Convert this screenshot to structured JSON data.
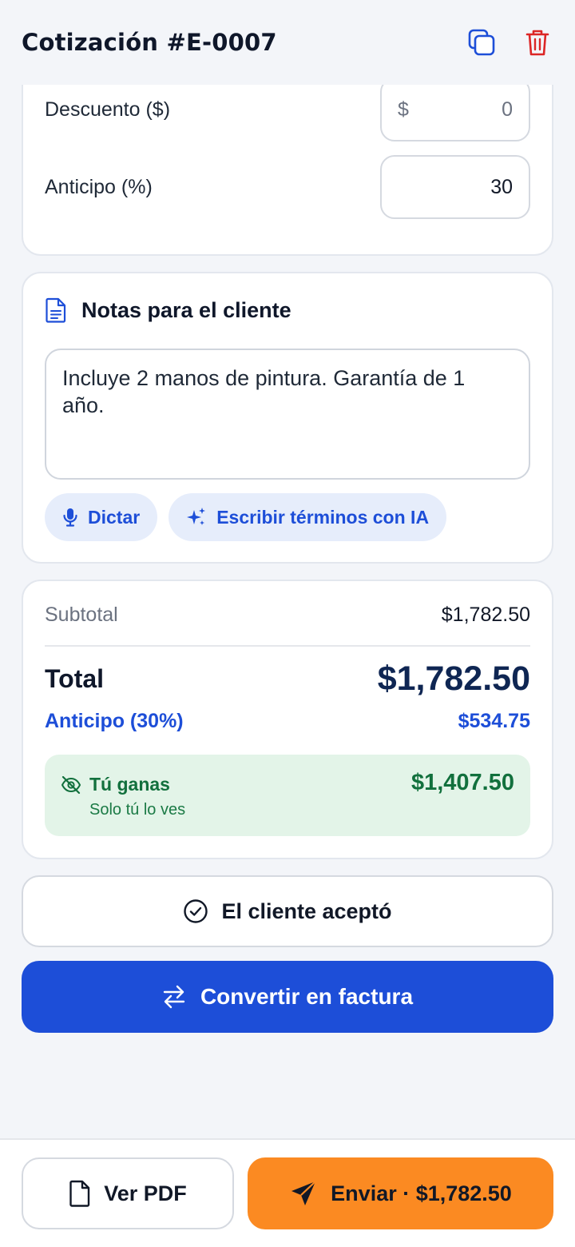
{
  "header": {
    "title": "Cotización #E-0007",
    "icons": {
      "duplicate": "duplicate-icon",
      "delete": "trash-icon"
    },
    "colors": {
      "duplicate": "#1d4ed8",
      "delete": "#dc2626"
    }
  },
  "adjustments": {
    "discount": {
      "label": "Descuento ($)",
      "prefix": "$",
      "value": "0"
    },
    "deposit": {
      "label": "Anticipo (%)",
      "value": "30"
    }
  },
  "notes": {
    "title": "Notas para el cliente",
    "icon": "document-icon",
    "text": "Incluye 2 manos de pintura. Garantía de 1 año.",
    "dictate_label": "Dictar",
    "dictate_icon": "microphone-icon",
    "ai_label": "Escribir términos con IA",
    "ai_icon": "sparkles-icon"
  },
  "totals": {
    "subtotal_label": "Subtotal",
    "subtotal_value": "$1,782.50",
    "total_label": "Total",
    "total_value": "$1,782.50",
    "deposit_label": "Anticipo (30%)",
    "deposit_value": "$534.75",
    "profit": {
      "title": "Tú ganas",
      "subtitle": "Solo tú lo ves",
      "value": "$1,407.50",
      "icon": "eye-off-icon"
    }
  },
  "actions": {
    "accept_label": "El cliente aceptó",
    "accept_icon": "check-circle-icon",
    "convert_label": "Convertir en factura",
    "convert_icon": "swap-arrows-icon"
  },
  "bottom_bar": {
    "pdf_label": "Ver PDF",
    "pdf_icon": "file-icon",
    "send_label": "Enviar · $1,782.50",
    "send_icon": "send-icon"
  },
  "colors": {
    "primary": "#1d4ed8",
    "accent_orange": "#fb8a22",
    "profit_green": "#12703d",
    "profit_bg": "#e3f4e8",
    "background": "#f3f5f9"
  }
}
